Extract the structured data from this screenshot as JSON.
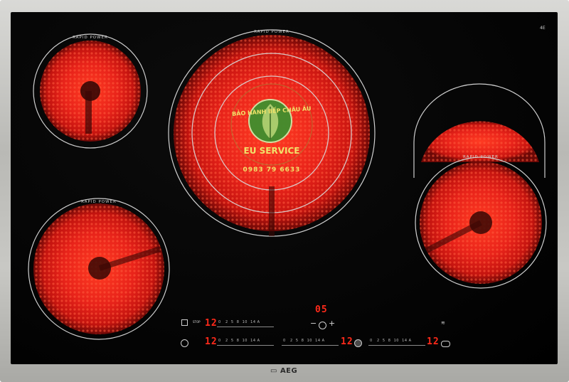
{
  "zone_label": "RAPID POWER",
  "brand": "AEG",
  "corner_mark": "4E",
  "watermark": {
    "line1": "BẢO HÀNH BẾP CHÂU ÂU",
    "line2": "EU SERVICE",
    "phone": "0983 79 6633"
  },
  "timer": {
    "display": "05",
    "minus": "−",
    "plus": "+"
  },
  "stop_label": "STOP",
  "zone_levels": [
    "12",
    "12",
    "12",
    "12"
  ],
  "scale_ticks": [
    "0",
    "2",
    "5",
    "8",
    "10",
    "14",
    "A"
  ],
  "colors": {
    "glow": "#e0201a",
    "glass": "#050505",
    "frame": "#bdbdb8",
    "display": "#ff2a1a"
  }
}
